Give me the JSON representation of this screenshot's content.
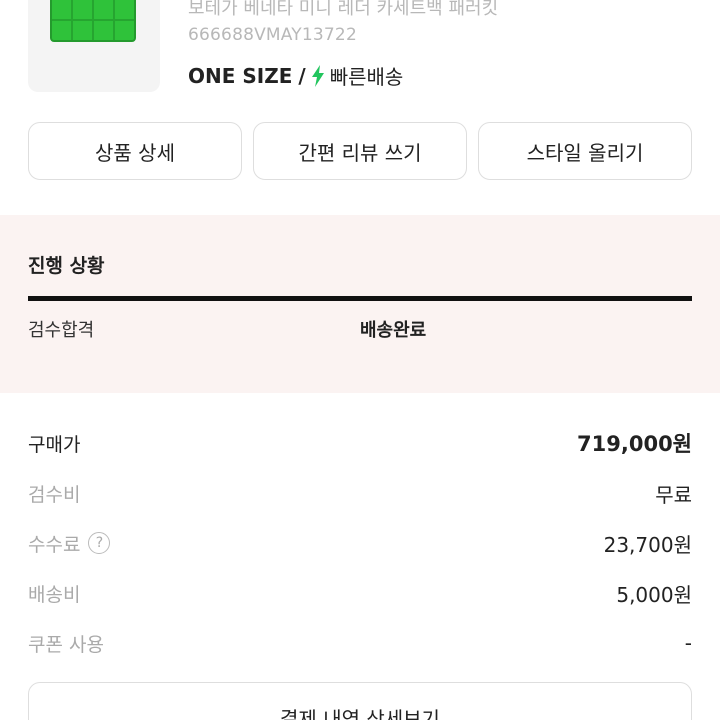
{
  "product": {
    "name": "보테가 베네타 미니 레더 카세트백 패러킷",
    "code": "666688VMAY13722",
    "size": "ONE SIZE",
    "separator": "/",
    "shipping": "빠른배송",
    "thumb_color": "#2fc23a",
    "bolt_color": "#22c55e",
    "bolt_icon": "lightning-bolt-icon"
  },
  "actions": {
    "detail": "상품 상세",
    "review": "간편 리뷰 쓰기",
    "style": "스타일 올리기"
  },
  "progress": {
    "title": "진행 상황",
    "steps": [
      "검수합격",
      "배송완료"
    ],
    "background": "#fbf3f2"
  },
  "price": {
    "purchase_label": "구매가",
    "purchase_value": "719,000원",
    "inspection_label": "검수비",
    "inspection_value": "무료",
    "fee_label": "수수료",
    "fee_value": "23,700원",
    "help_icon": "?",
    "delivery_label": "배송비",
    "delivery_value": "5,000원",
    "coupon_label": "쿠폰 사용",
    "coupon_value": "-"
  },
  "footer": {
    "detail_button": "결제 내역 상세보기"
  }
}
